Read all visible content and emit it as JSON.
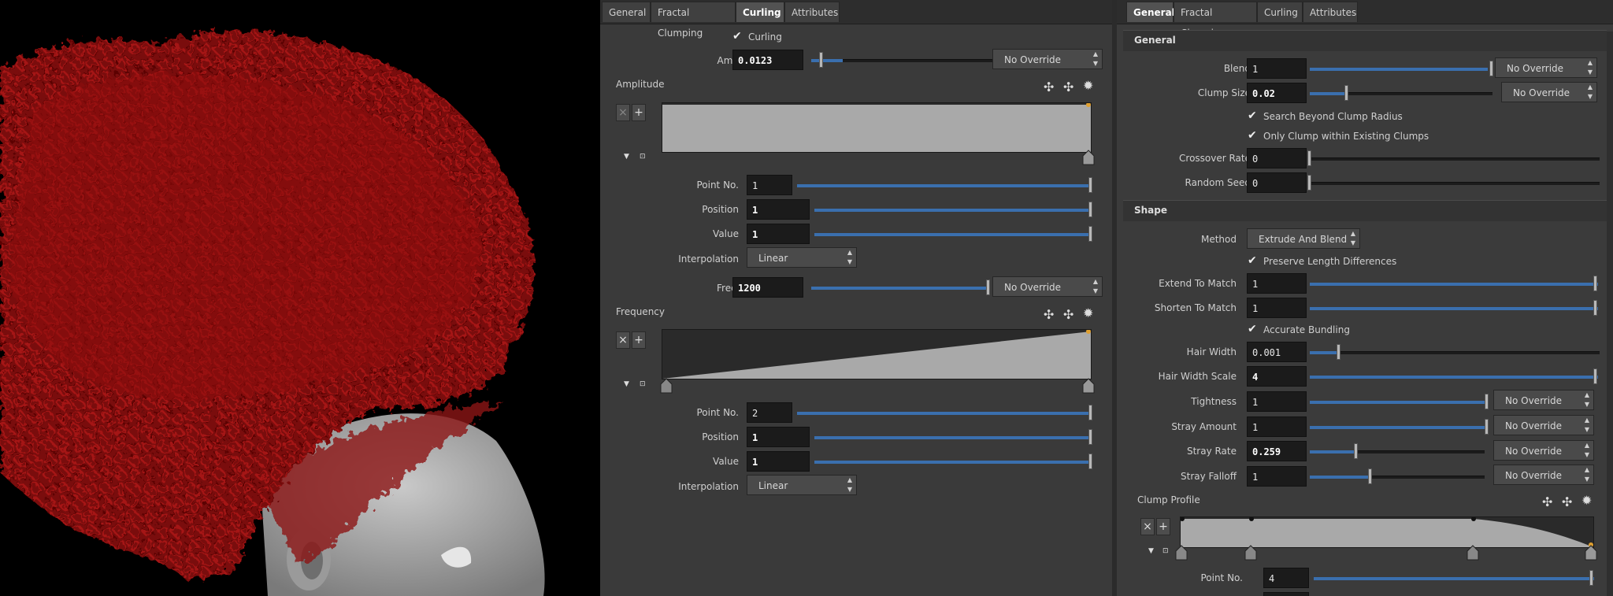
{
  "panel1": {
    "tabs": [
      "General",
      "Fractal Clumping",
      "Curling",
      "Attributes"
    ],
    "active_tab": "Curling",
    "curling_toggle": "Curling",
    "amplitude": {
      "label": "Amplitude",
      "value": "0.0123",
      "override": "No Override"
    },
    "amplitude_ramp": {
      "title": "Amplitude",
      "remove": "×",
      "add": "+",
      "point_no_label": "Point No.",
      "point_no": "1",
      "position_label": "Position",
      "position": "1",
      "value_label": "Value",
      "value": "1",
      "interp_label": "Interpolation",
      "interp": "Linear"
    },
    "frequency": {
      "label": "Frequency",
      "value": "1200",
      "override": "No Override"
    },
    "frequency_ramp": {
      "title": "Frequency",
      "remove": "×",
      "add": "+",
      "point_no_label": "Point No.",
      "point_no": "2",
      "position_label": "Position",
      "position": "1",
      "value_label": "Value",
      "value": "1",
      "interp_label": "Interpolation",
      "interp": "Linear"
    }
  },
  "panel2": {
    "tabs": [
      "General",
      "Fractal Clumping",
      "Curling",
      "Attributes"
    ],
    "active_tab": "General",
    "general_section": "General",
    "blend": {
      "label": "Blend",
      "value": "1",
      "override": "No Override"
    },
    "clump_size": {
      "label": "Clump Size",
      "value": "0.02",
      "override": "No Override"
    },
    "search_beyond": "Search Beyond Clump Radius",
    "only_clump": "Only Clump within Existing Clumps",
    "crossover_rate": {
      "label": "Crossover Rate",
      "value": "0"
    },
    "random_seed": {
      "label": "Random Seed",
      "value": "0"
    },
    "shape_section": "Shape",
    "method": {
      "label": "Method",
      "value": "Extrude And Blend"
    },
    "preserve_length": "Preserve Length Differences",
    "extend_to_match": {
      "label": "Extend To Match",
      "value": "1"
    },
    "shorten_to_match": {
      "label": "Shorten To Match",
      "value": "1"
    },
    "accurate_bundling": "Accurate Bundling",
    "hair_width": {
      "label": "Hair Width",
      "value": "0.001"
    },
    "hair_width_scale": {
      "label": "Hair Width Scale",
      "value": "4"
    },
    "tightness": {
      "label": "Tightness",
      "value": "1",
      "override": "No Override"
    },
    "stray_amount": {
      "label": "Stray Amount",
      "value": "1",
      "override": "No Override"
    },
    "stray_rate": {
      "label": "Stray Rate",
      "value": "0.259",
      "override": "No Override"
    },
    "stray_falloff": {
      "label": "Stray Falloff",
      "value": "1",
      "override": "No Override"
    },
    "clump_profile": {
      "title": "Clump Profile",
      "remove": "×",
      "add": "+",
      "point_no_label": "Point No.",
      "point_no": "4"
    }
  },
  "colors": {
    "hair": "#8a0c0c",
    "slider_fill": "#3a6fae",
    "panel_bg": "#3a3a3a"
  }
}
